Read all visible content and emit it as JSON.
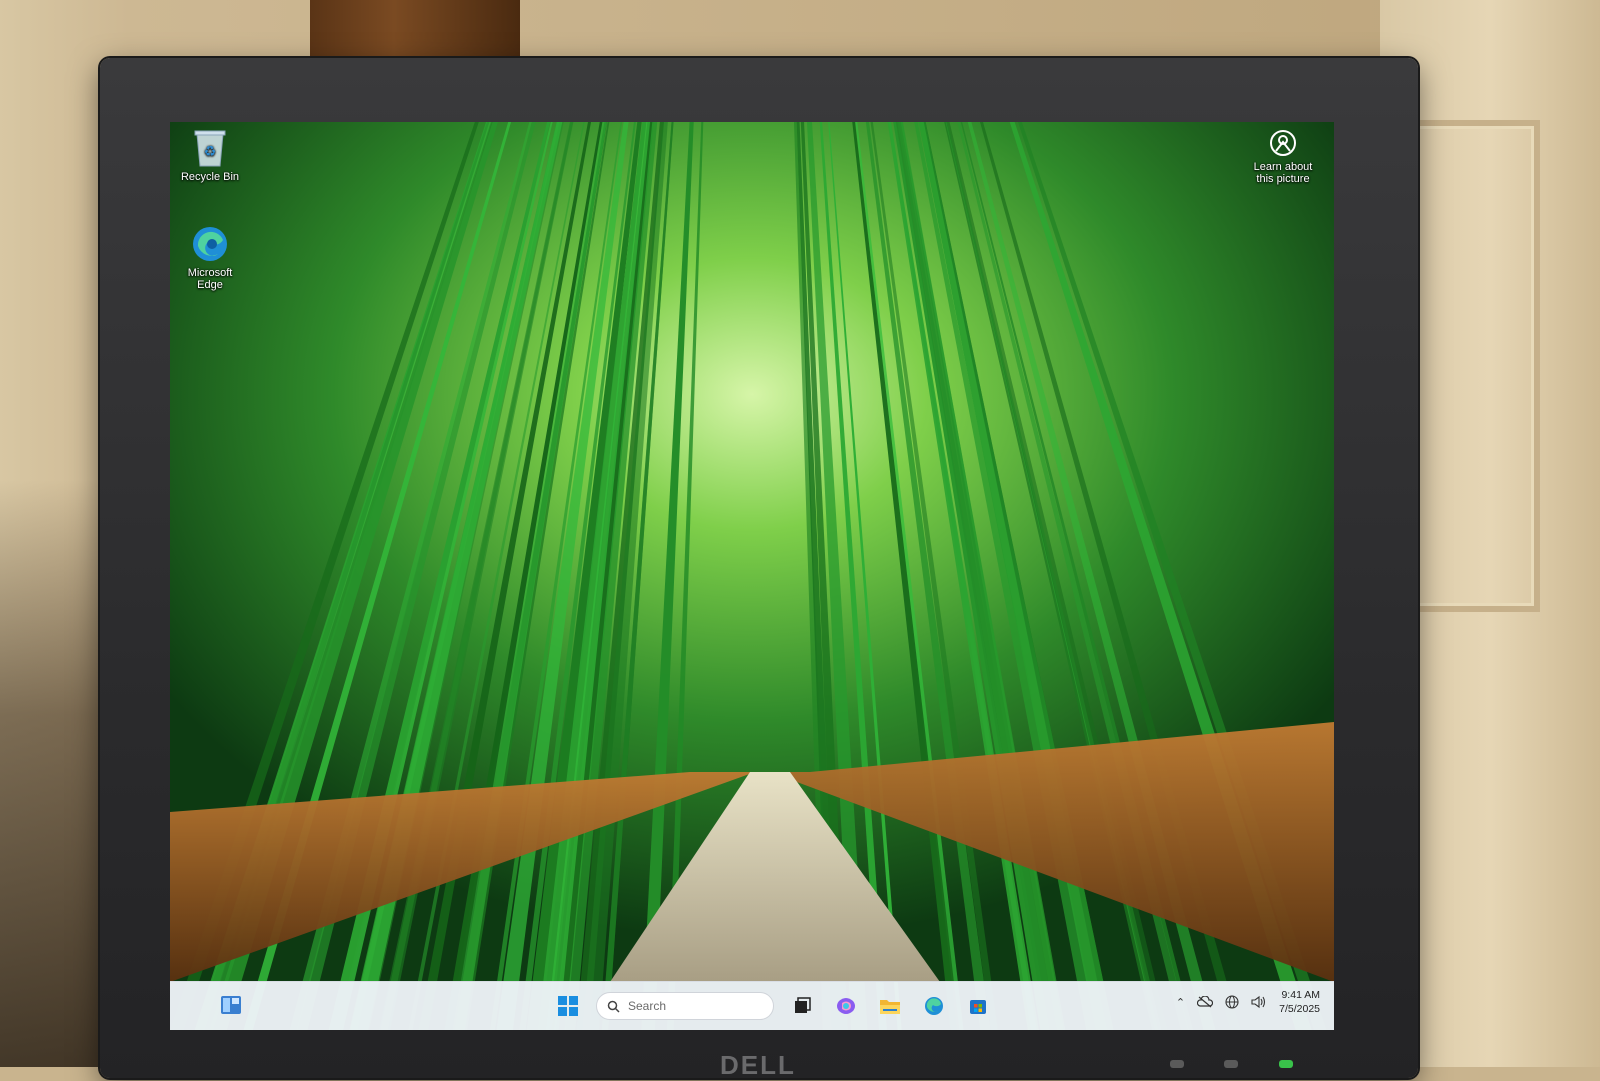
{
  "desktop": {
    "icons": [
      {
        "name": "recycle-bin",
        "label": "Recycle Bin"
      },
      {
        "name": "microsoft-edge",
        "label_line1": "Microsoft",
        "label_line2": "Edge"
      }
    ],
    "spotlight": {
      "line1": "Learn about",
      "line2": "this picture"
    }
  },
  "taskbar": {
    "search_placeholder": "Search",
    "pinned": [
      "widgets-icon",
      "start-icon",
      "search-icon",
      "task-view-icon",
      "copilot-icon",
      "file-explorer-icon",
      "edge-icon",
      "store-icon"
    ],
    "tray_icons": [
      "chevron-up-icon",
      "onedrive-icon",
      "network-icon",
      "volume-icon"
    ],
    "time": "9:41 AM",
    "date": "7/5/2025"
  },
  "monitor": {
    "brand": "DELL"
  }
}
